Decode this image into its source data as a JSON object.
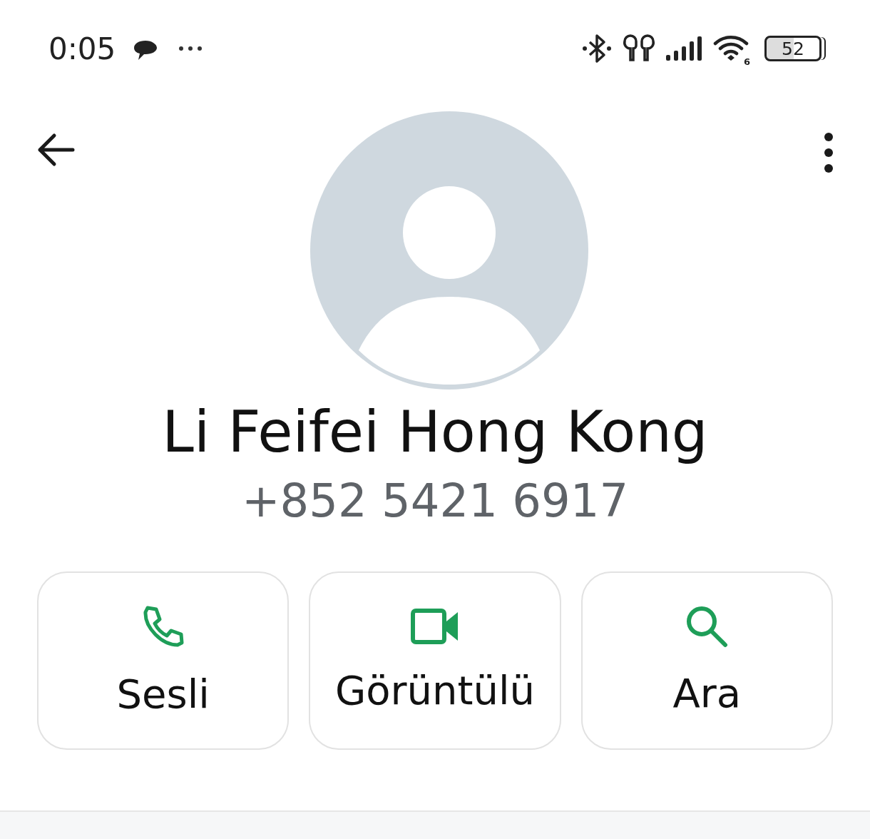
{
  "status_bar": {
    "time": "0:05",
    "battery": "52",
    "wifi_badge": "6"
  },
  "contact": {
    "name": "Li Feifei Hong Kong",
    "phone": "+852 5421 6917"
  },
  "actions": [
    {
      "kind": "voice",
      "label": "Sesli"
    },
    {
      "kind": "video",
      "label": "Görüntülü"
    },
    {
      "kind": "search",
      "label": "Ara"
    }
  ]
}
